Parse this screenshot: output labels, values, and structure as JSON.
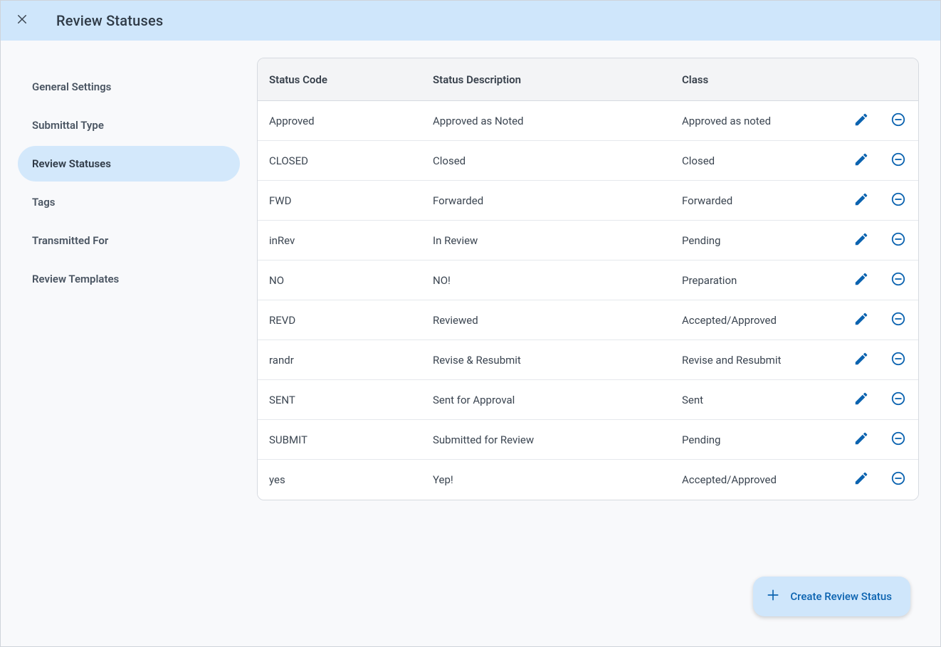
{
  "header": {
    "title": "Review Statuses"
  },
  "sidebar": {
    "items": [
      {
        "label": "General Settings"
      },
      {
        "label": "Submittal Type"
      },
      {
        "label": "Review Statuses"
      },
      {
        "label": "Tags"
      },
      {
        "label": "Transmitted For"
      },
      {
        "label": "Review Templates"
      }
    ],
    "activeIndex": 2
  },
  "table": {
    "columns": {
      "code": "Status Code",
      "desc": "Status Description",
      "klass": "Class"
    },
    "rows": [
      {
        "code": "Approved",
        "desc": "Approved as Noted",
        "klass": "Approved as noted"
      },
      {
        "code": "CLOSED",
        "desc": "Closed",
        "klass": "Closed"
      },
      {
        "code": "FWD",
        "desc": "Forwarded",
        "klass": "Forwarded"
      },
      {
        "code": "inRev",
        "desc": "In Review",
        "klass": "Pending"
      },
      {
        "code": "NO",
        "desc": "NO!",
        "klass": "Preparation"
      },
      {
        "code": "REVD",
        "desc": "Reviewed",
        "klass": "Accepted/Approved"
      },
      {
        "code": "randr",
        "desc": "Revise & Resubmit",
        "klass": "Revise and Resubmit"
      },
      {
        "code": "SENT",
        "desc": "Sent for Approval",
        "klass": "Sent"
      },
      {
        "code": "SUBMIT",
        "desc": "Submitted for Review",
        "klass": "Pending"
      },
      {
        "code": "yes",
        "desc": "Yep!",
        "klass": "Accepted/Approved"
      }
    ]
  },
  "fab": {
    "label": "Create Review Status"
  }
}
